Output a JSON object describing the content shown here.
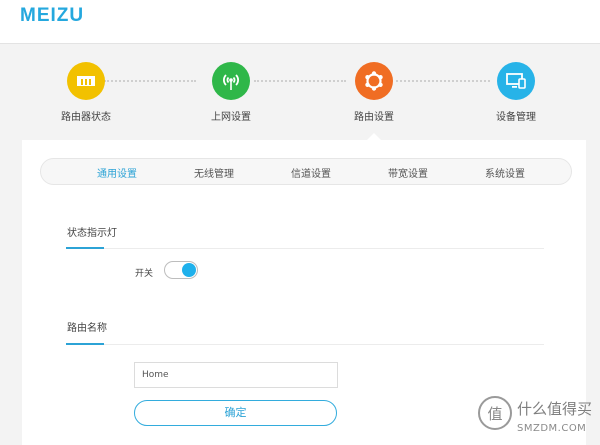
{
  "brand": {
    "logo_text": "MEIZU",
    "color": "#25a8de"
  },
  "steps": [
    {
      "label": "路由器状态",
      "icon": "router-status-icon",
      "color": "#f2c100"
    },
    {
      "label": "上网设置",
      "icon": "antenna-icon",
      "color": "#2fb749"
    },
    {
      "label": "路由设置",
      "icon": "gear-icon",
      "color": "#f06d23",
      "active": true
    },
    {
      "label": "设备管理",
      "icon": "monitor-icon",
      "color": "#27b3e8"
    }
  ],
  "tabs": [
    {
      "label": "通用设置",
      "active": true
    },
    {
      "label": "无线管理"
    },
    {
      "label": "信道设置"
    },
    {
      "label": "带宽设置"
    },
    {
      "label": "系统设置"
    }
  ],
  "status_light": {
    "title": "状态指示灯",
    "switch_label": "开关",
    "switch_on": true
  },
  "router_name": {
    "title": "路由名称",
    "value": "Home",
    "confirm_label": "确定"
  },
  "watermark": {
    "text": "什么值得买",
    "sub": "SMZDM.COM",
    "icon_char": "值"
  },
  "accent": "#2ca3d6"
}
